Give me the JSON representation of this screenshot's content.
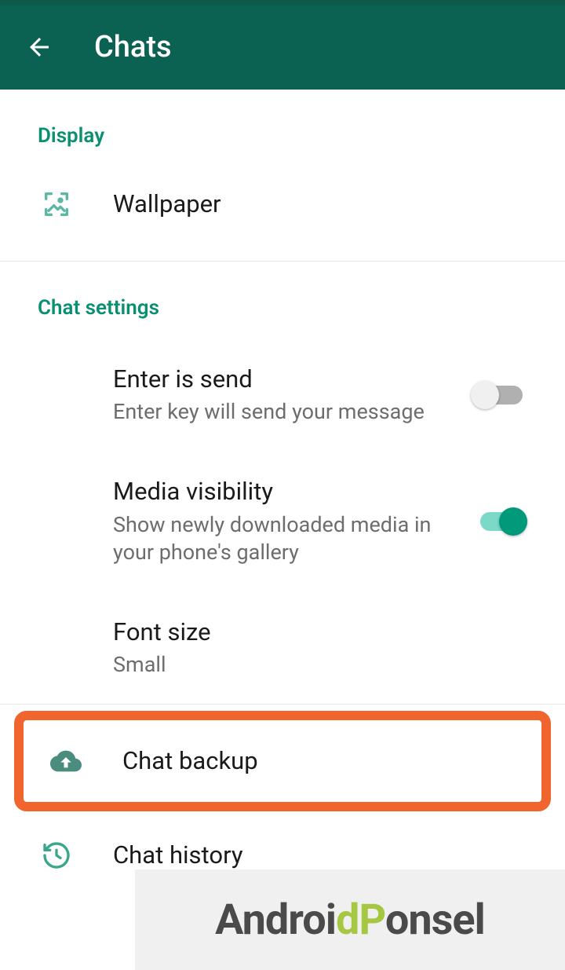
{
  "header": {
    "title": "Chats"
  },
  "sections": {
    "display": {
      "header": "Display",
      "wallpaper": "Wallpaper"
    },
    "chatSettings": {
      "header": "Chat settings",
      "enterIsSend": {
        "title": "Enter is send",
        "subtitle": "Enter key will send your message"
      },
      "mediaVisibility": {
        "title": "Media visibility",
        "subtitle": "Show newly downloaded media in your phone's gallery"
      },
      "fontSize": {
        "title": "Font size",
        "subtitle": "Small"
      }
    },
    "chatBackup": "Chat backup",
    "chatHistory": "Chat history"
  },
  "watermark": {
    "part1": "Androi",
    "part2": "dP",
    "part3": "onsel"
  }
}
